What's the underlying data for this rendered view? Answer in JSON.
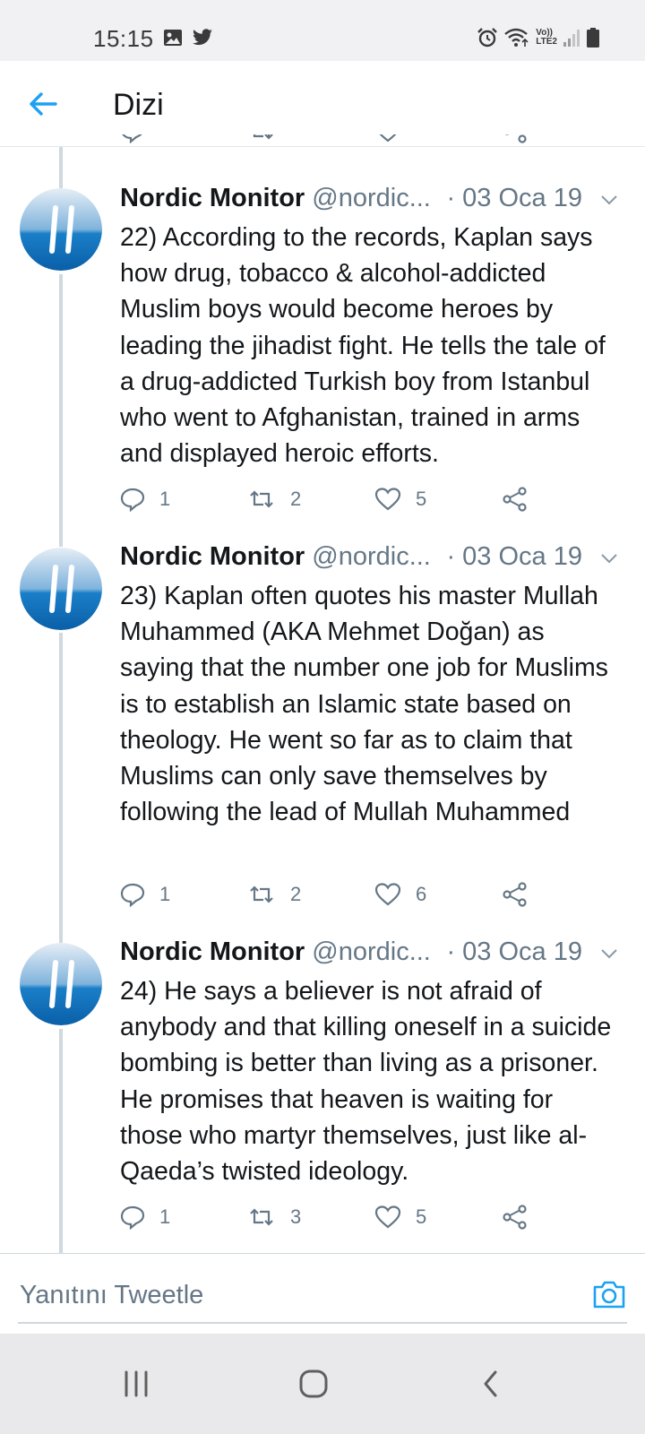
{
  "status_bar": {
    "time": "15:15",
    "network_label_top": "Vo))",
    "network_label_bottom": "LTE2",
    "icons": [
      "image-icon",
      "twitter-bird-icon",
      "alarm-icon",
      "wifi-icon",
      "signal-icon",
      "battery-icon"
    ]
  },
  "app_bar": {
    "title": "Dizi",
    "back_icon": "arrow-left-icon"
  },
  "tweets": [
    {
      "name": "Nordic Monitor",
      "handle": "@nordic...",
      "date": "· 03 Oca 19",
      "text": "22) According to the records, Kaplan says how drug, tobacco & alcohol-addicted Muslim boys would become heroes by leading the jihadist fight. He tells the tale of a drug-addicted Turkish boy from Istanbul who went to Afghanistan, trained in arms and displayed heroic efforts.",
      "replies": "1",
      "retweets": "2",
      "likes": "5"
    },
    {
      "name": "Nordic Monitor",
      "handle": "@nordic...",
      "date": "· 03 Oca 19",
      "text": "23) Kaplan often quotes his master Mullah Muhammed (AKA Mehmet Doğan) as saying that the number one job for Muslims is to establish an Islamic state based on theology. He went so far as to claim that Muslims can only save themselves by following the lead of Mullah Muhammed",
      "replies": "1",
      "retweets": "2",
      "likes": "6"
    },
    {
      "name": "Nordic Monitor",
      "handle": "@nordic...",
      "date": "· 03 Oca 19",
      "text": "24) He says a believer is not afraid of anybody and that killing oneself in a suicide bombing is better than living as a prisoner. He promises that heaven is waiting for those who martyr themselves, just like al-Qaeda’s twisted ideology.",
      "replies": "1",
      "retweets": "3",
      "likes": "5"
    }
  ],
  "reply_bar": {
    "placeholder": "Yanıtını Tweetle"
  },
  "colors": {
    "accent": "#1da1f2",
    "text_primary": "#14171a",
    "text_secondary": "#657786",
    "divider": "#cfd9de"
  }
}
